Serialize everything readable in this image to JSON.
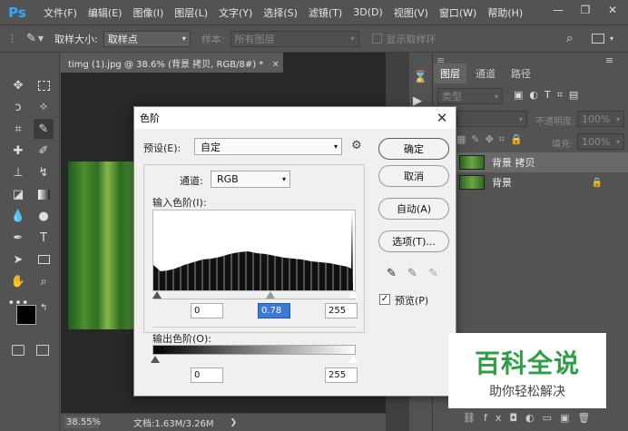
{
  "app": {
    "logo": "Ps"
  },
  "menu": [
    "文件(F)",
    "编辑(E)",
    "图像(I)",
    "图层(L)",
    "文字(Y)",
    "选择(S)",
    "滤镜(T)",
    "3D(D)",
    "视图(V)",
    "窗口(W)",
    "帮助(H)"
  ],
  "options_bar": {
    "sample_size_label": "取样大小:",
    "sample_size_value": "取样点",
    "sample_label": "样本:",
    "sample_value": "所有图层",
    "show_ring_label": "显示取样环"
  },
  "document": {
    "tab_title": "timg (1).jpg @ 38.6% (背景 拷贝, RGB/8#) *",
    "zoom": "38.55%",
    "doc_info": "文档:1.63M/3.26M"
  },
  "panels": {
    "tabs": [
      "图层",
      "通道",
      "路径"
    ],
    "kind_label": "类型",
    "opacity_label": "不透明度:",
    "opacity_value": "100%",
    "fill_label": "填充:",
    "fill_value": "100%",
    "layers": [
      {
        "name": "背景 拷贝"
      },
      {
        "name": "背景"
      }
    ]
  },
  "levels_dialog": {
    "title": "色阶",
    "preset_label": "预设(E):",
    "preset_value": "自定",
    "channel_label": "通道:",
    "channel_value": "RGB",
    "input_levels_label": "输入色阶(I):",
    "input_black": "0",
    "input_gamma": "0.78",
    "input_white": "255",
    "output_levels_label": "输出色阶(O):",
    "output_black": "0",
    "output_white": "255",
    "buttons": {
      "ok": "确定",
      "cancel": "取消",
      "auto": "自动(A)",
      "options": "选项(T)..."
    },
    "preview_label": "预览(P)",
    "preview_checked": true
  },
  "watermark": {
    "title": "百科全说",
    "subtitle": "助你轻松解决"
  }
}
